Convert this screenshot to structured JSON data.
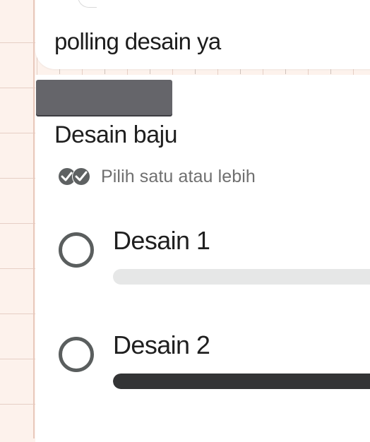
{
  "message": {
    "text": "polling desain ya"
  },
  "poll": {
    "question": "Desain baju",
    "hint": "Pilih satu atau lebih",
    "hint_icon": "double-check-icon",
    "options": [
      {
        "label": "Desain 1",
        "share": 0.0,
        "selected": false
      },
      {
        "label": "Desain 2",
        "share": 1.0,
        "selected": false
      }
    ]
  },
  "colors": {
    "background": "#fdf2ec",
    "card": "#ffffff",
    "bar_track": "#e6e7e7",
    "bar_fill": "#333435",
    "radio": "#5a5e5e",
    "redaction": "#65656a"
  }
}
